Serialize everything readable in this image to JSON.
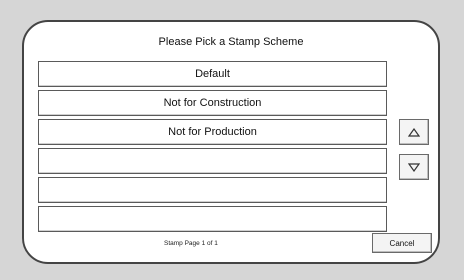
{
  "dialog": {
    "title": "Please Pick a Stamp Scheme",
    "schemes": [
      {
        "label": "Default"
      },
      {
        "label": "Not for Construction"
      },
      {
        "label": "Not for Production"
      },
      {
        "label": ""
      },
      {
        "label": ""
      },
      {
        "label": ""
      }
    ],
    "scroll_up_icon": "triangle-up-icon",
    "scroll_down_icon": "triangle-down-icon",
    "page_indicator": "Stamp Page 1 of 1",
    "cancel_label": "Cancel"
  },
  "colors": {
    "background": "#d6d6d6",
    "dialog_background": "#ffffff",
    "border": "#444444"
  }
}
